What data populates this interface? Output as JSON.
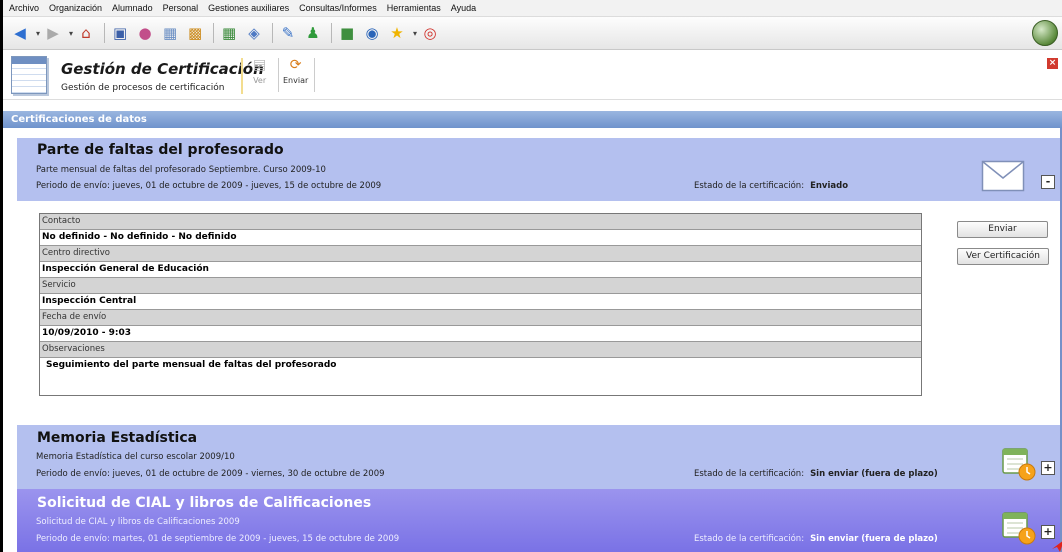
{
  "menu": [
    "Archivo",
    "Organización",
    "Alumnado",
    "Personal",
    "Gestiones auxiliares",
    "Consultas/Informes",
    "Herramientas",
    "Ayuda"
  ],
  "header": {
    "title": "Gestión de Certificación",
    "subtitle": "Gestión de procesos de certificación",
    "actions": {
      "ver": "Ver",
      "enviar": "Enviar"
    }
  },
  "section_title": "Certificaciones de datos",
  "estado_label": "Estado de la certificación:",
  "panels": [
    {
      "title": "Parte de faltas del profesorado",
      "description": "Parte mensual de faltas del profesorado Septiembre. Curso 2009-10",
      "period": "Periodo de envío: jueves, 01 de octubre de 2009 - jueves, 15 de octubre de 2009",
      "estado": "Enviado",
      "toggle": "-",
      "icon": "envelope-icon"
    },
    {
      "title": "Memoria Estadística",
      "description": "Memoria Estadística del curso escolar 2009/10",
      "period": "Periodo de envío: jueves, 01 de octubre de 2009 - viernes, 30 de octubre de 2009",
      "estado": "Sin enviar (fuera de plazo)",
      "toggle": "+",
      "icon": "calendar-clock-icon"
    },
    {
      "title": "Solicitud de CIAL y libros de Calificaciones",
      "description": "Solicitud de CIAL y libros de Calificaciones 2009",
      "period": "Periodo de envío: martes, 01 de septiembre de 2009 - jueves, 15 de octubre de 2009",
      "estado": "Sin enviar (fuera de plazo)",
      "toggle": "+",
      "icon": "calendar-clock-icon"
    }
  ],
  "details": {
    "contacto_label": "Contacto",
    "contacto": "No definido - No definido - No definido",
    "centro_label": "Centro directivo",
    "centro": "Inspección General de Educación",
    "servicio_label": "Servicio",
    "servicio": "Inspección Central",
    "fecha_label": "Fecha de envío",
    "fecha": "10/09/2010 - 9:03",
    "observaciones_label": "Observaciones",
    "observaciones": "Seguimiento del parte mensual de faltas del profesorado"
  },
  "buttons": {
    "enviar": "Enviar",
    "ver_certificacion": "Ver Certificación"
  },
  "colors": {
    "panel_bg": "#b4c0ef",
    "panel_active_bg": "#8a82ea",
    "section_bar": "#7b9bd2"
  }
}
